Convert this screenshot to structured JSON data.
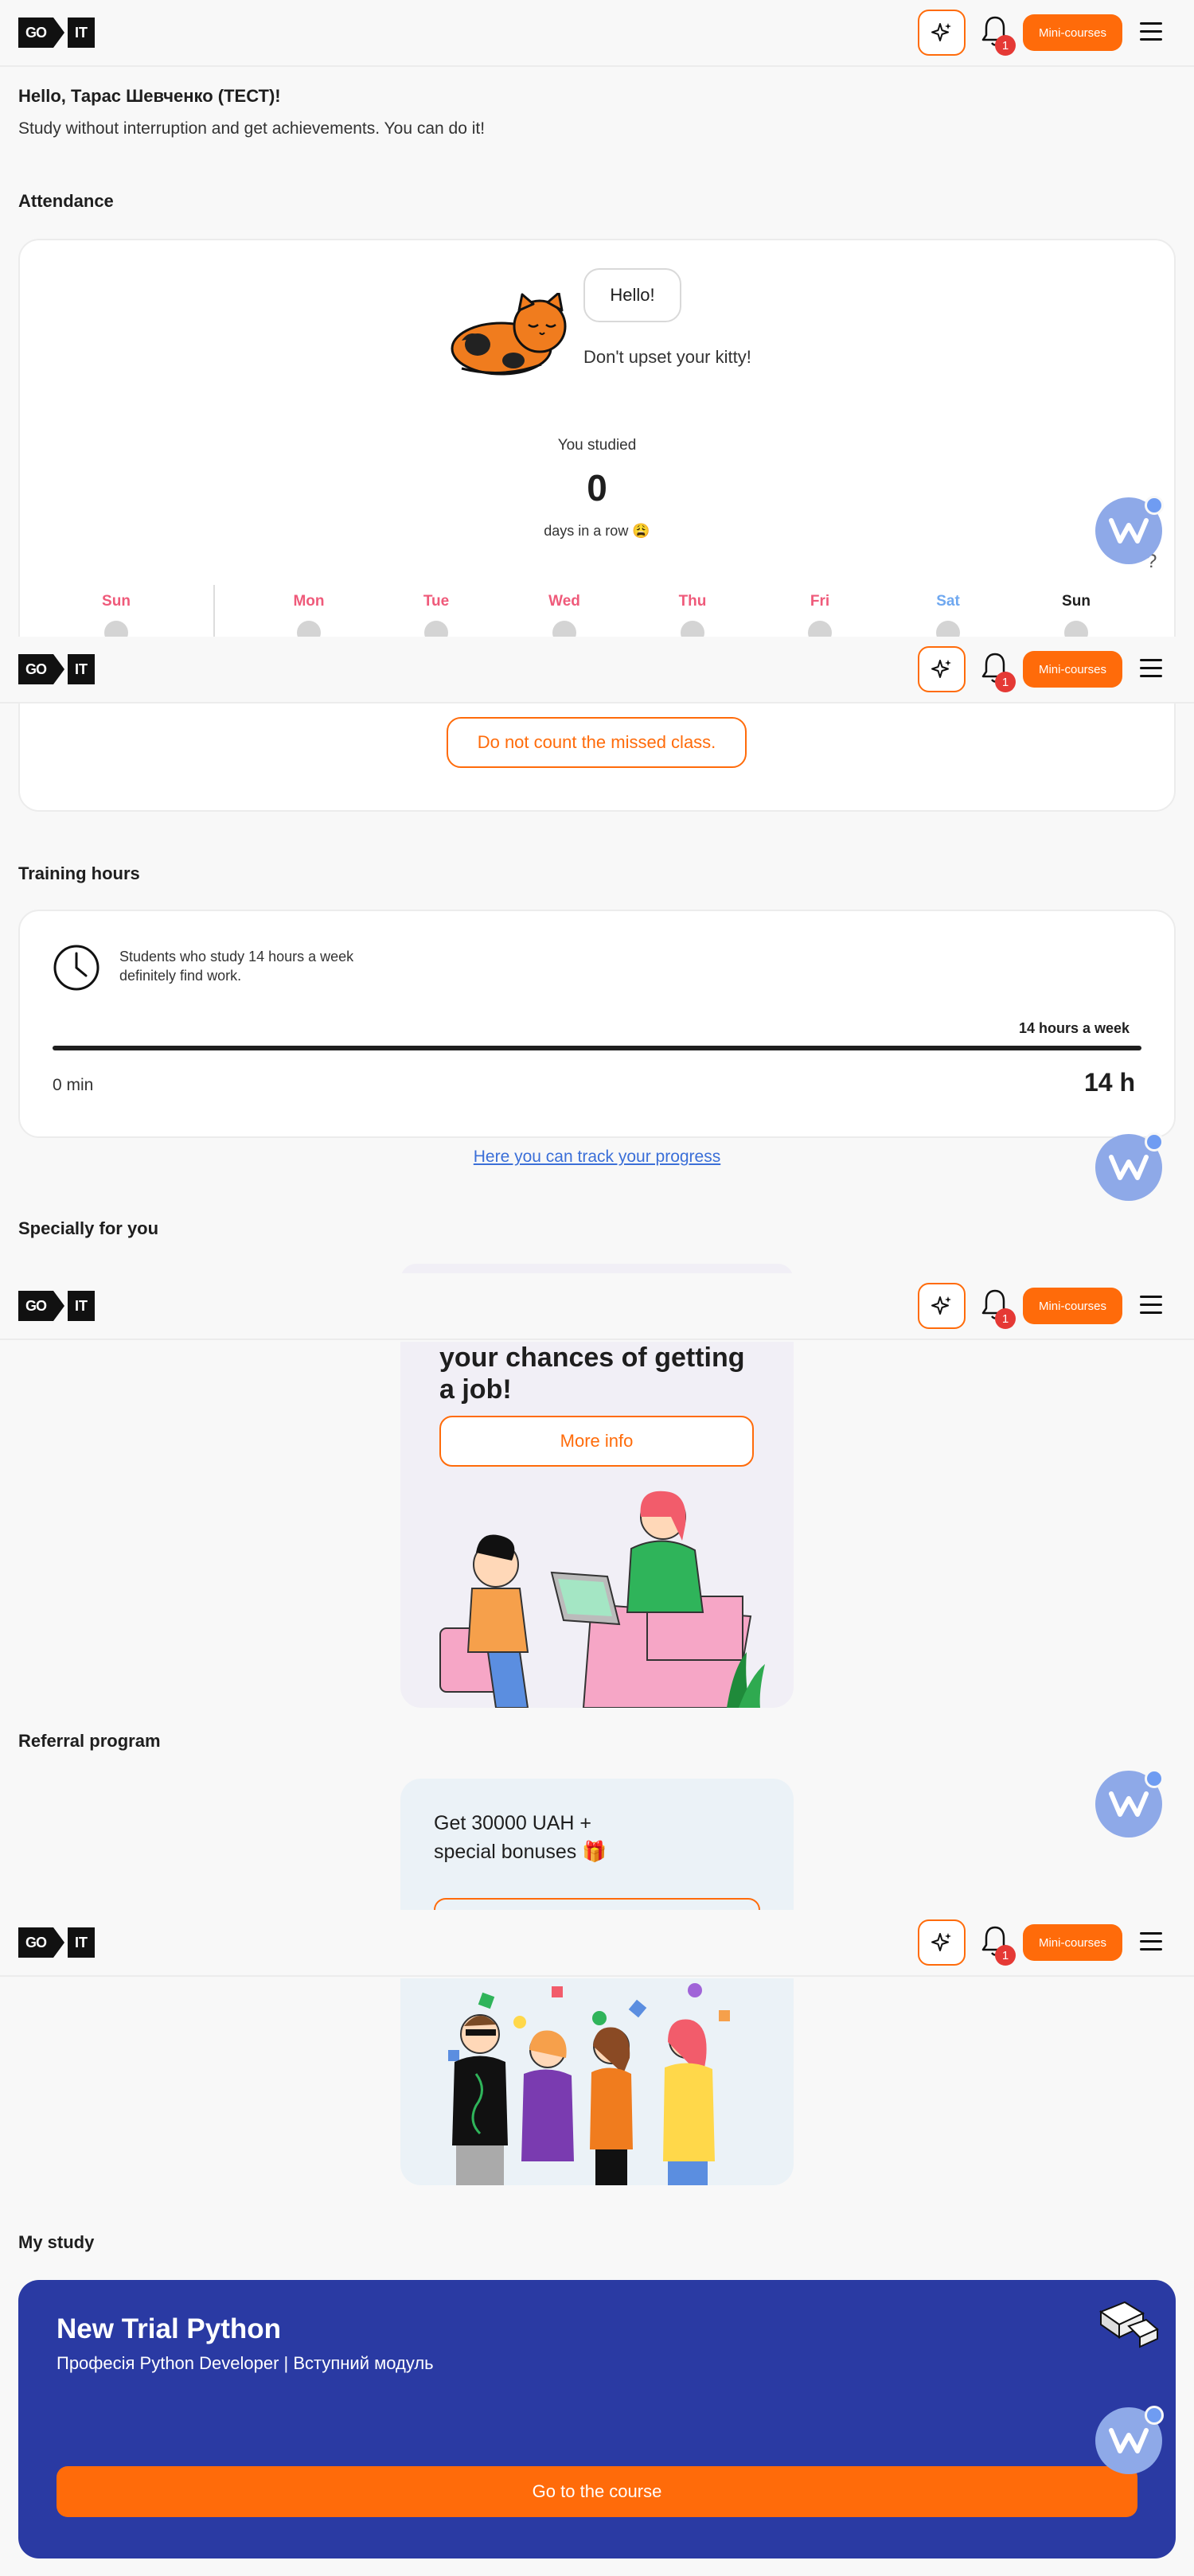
{
  "header": {
    "logo_go": "GO",
    "logo_it": "IT",
    "notification_count": "1",
    "mini_courses_label": "Mini-courses"
  },
  "greeting": {
    "title": "Hello, Тарас Шевченко (ТЕСТ)!",
    "subtitle": "Study without interruption and get achievements. You can do it!"
  },
  "attendance": {
    "heading": "Attendance",
    "bubble_text": "Hello!",
    "kitty_text": "Don't upset your kitty!",
    "studied_label": "You studied",
    "streak_count": "0",
    "streak_unit": "days in a row 😩",
    "days": [
      {
        "label": "Sun",
        "color": "#ef5a7a"
      },
      {
        "label": "Mon",
        "color": "#ef5a7a"
      },
      {
        "label": "Tue",
        "color": "#ef5a7a"
      },
      {
        "label": "Wed",
        "color": "#ef5a7a"
      },
      {
        "label": "Thu",
        "color": "#ef5a7a"
      },
      {
        "label": "Fri",
        "color": "#ef5a7a"
      },
      {
        "label": "Sat",
        "color": "#6fa8f0"
      },
      {
        "label": "Sun",
        "color": "#1e1e1e"
      }
    ],
    "question_mark": "?",
    "missed_button": "Do not count the missed class."
  },
  "training": {
    "heading": "Training hours",
    "info_text": "Students who study 14 hours a week definitely find work.",
    "goal_label": "14 hours a week",
    "current_value": "0 min",
    "goal_value": "14 h",
    "progress_fraction": 0,
    "track_link": "Here you can track your progress"
  },
  "special": {
    "heading": "Specially for you",
    "promo_title": "your chances of getting a job!",
    "more_info_button": "More info"
  },
  "referral": {
    "heading": "Referral program",
    "promo_text_line1": "Get 30000 UAH +",
    "promo_text_line2": "special bonuses 🎁"
  },
  "my_study": {
    "heading": "My study",
    "course_title": "New Trial Python",
    "course_subtitle": "Професія Python Developer | Вступний модуль",
    "go_button": "Go to the course"
  },
  "colors": {
    "accent": "#ff6b0a",
    "course_bg": "#2a3aa3",
    "fab": "#8ea9e8"
  }
}
